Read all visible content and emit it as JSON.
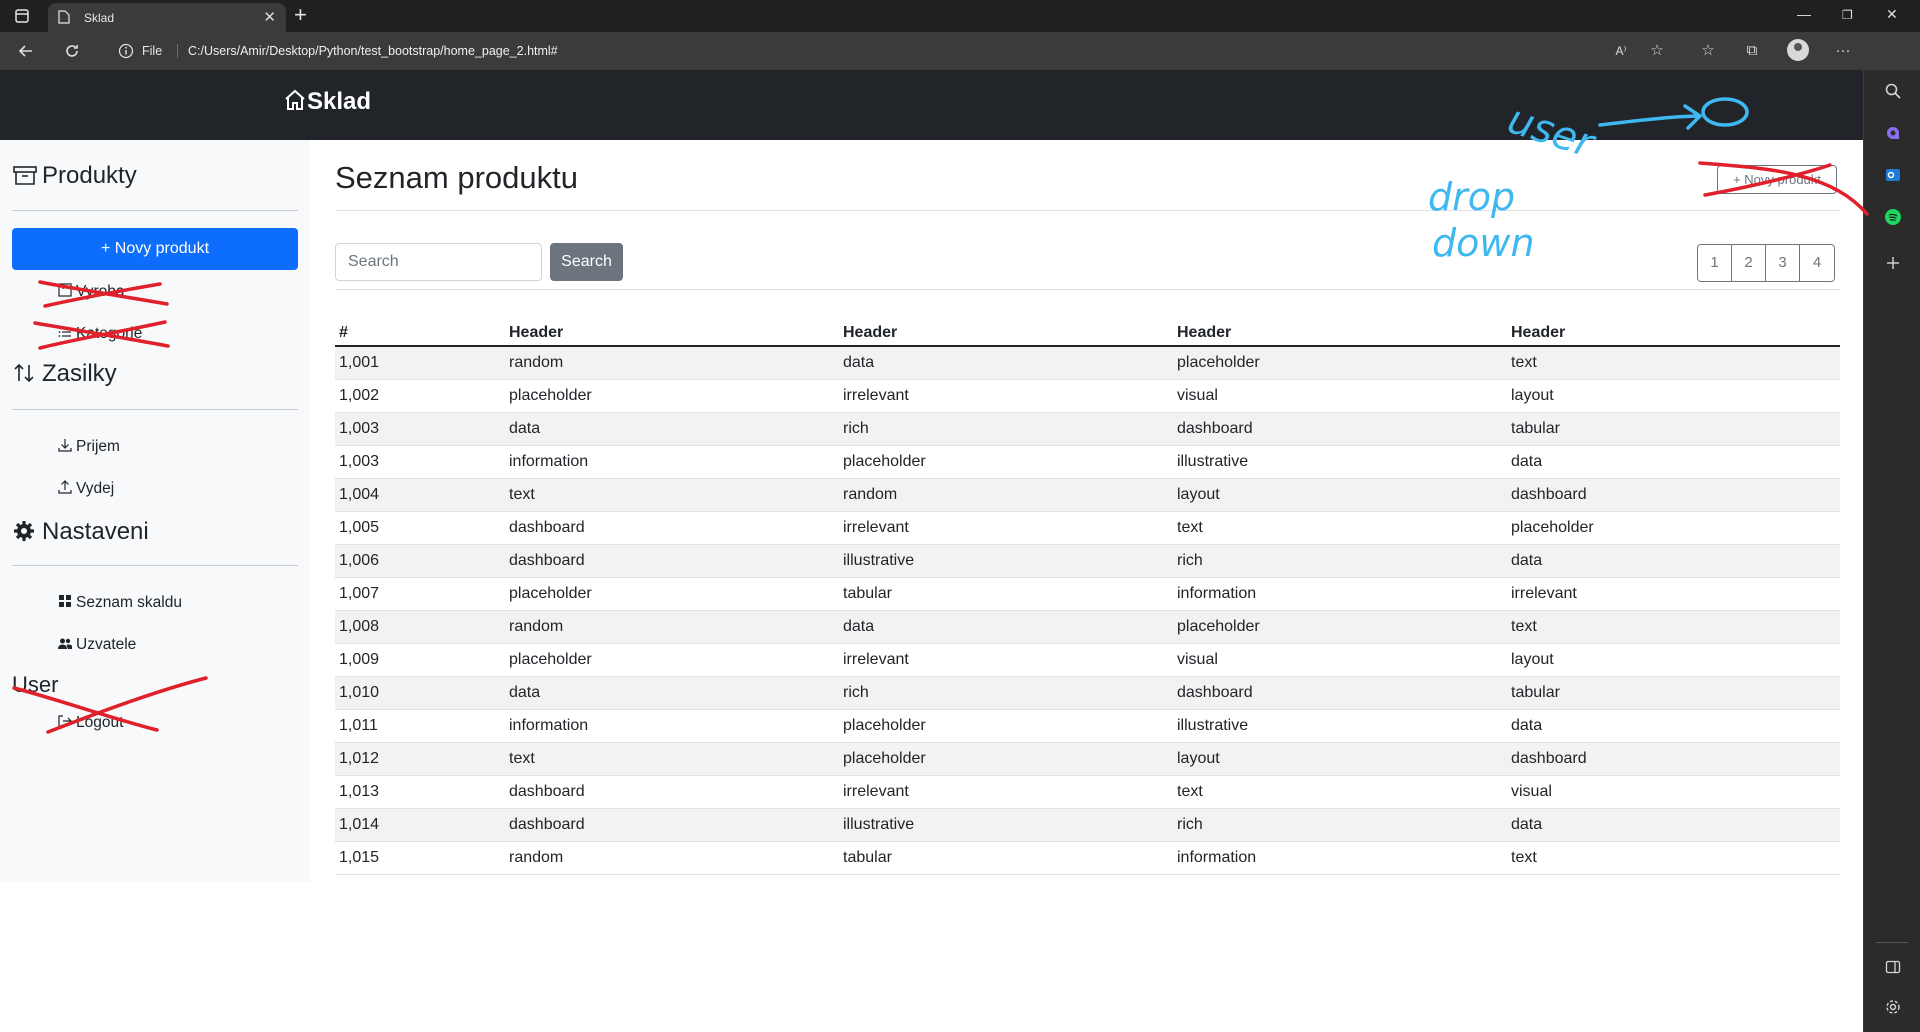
{
  "browser": {
    "tab_title": "Sklad",
    "file_label": "File",
    "url": "C:/Users/Amir/Desktop/Python/test_bootstrap/home_page_2.html#",
    "read_aloud_label": "A⁾"
  },
  "navbar": {
    "brand": "Sklad"
  },
  "sidebar": {
    "produkty": {
      "title": "Produkty",
      "new_button": "+ Novy produkt",
      "links": [
        "Vyroba",
        "Kategorie"
      ]
    },
    "zasilky": {
      "title": "Zasilky",
      "links": [
        "Prijem",
        "Vydej"
      ]
    },
    "nastaveni": {
      "title": "Nastaveni",
      "links": [
        "Seznam skaldu",
        "Uzvatele"
      ]
    },
    "user": {
      "title": "User",
      "links": [
        "Logout"
      ]
    }
  },
  "main": {
    "title": "Seznam produktu",
    "new_product_button": "+ Novy produkt",
    "search": {
      "placeholder": "Search",
      "button": "Search"
    },
    "pagination": [
      "1",
      "2",
      "3",
      "4"
    ]
  },
  "table": {
    "headers": [
      "#",
      "Header",
      "Header",
      "Header",
      "Header"
    ],
    "rows": [
      [
        "1,001",
        "random",
        "data",
        "placeholder",
        "text"
      ],
      [
        "1,002",
        "placeholder",
        "irrelevant",
        "visual",
        "layout"
      ],
      [
        "1,003",
        "data",
        "rich",
        "dashboard",
        "tabular"
      ],
      [
        "1,003",
        "information",
        "placeholder",
        "illustrative",
        "data"
      ],
      [
        "1,004",
        "text",
        "random",
        "layout",
        "dashboard"
      ],
      [
        "1,005",
        "dashboard",
        "irrelevant",
        "text",
        "placeholder"
      ],
      [
        "1,006",
        "dashboard",
        "illustrative",
        "rich",
        "data"
      ],
      [
        "1,007",
        "placeholder",
        "tabular",
        "information",
        "irrelevant"
      ],
      [
        "1,008",
        "random",
        "data",
        "placeholder",
        "text"
      ],
      [
        "1,009",
        "placeholder",
        "irrelevant",
        "visual",
        "layout"
      ],
      [
        "1,010",
        "data",
        "rich",
        "dashboard",
        "tabular"
      ],
      [
        "1,011",
        "information",
        "placeholder",
        "illustrative",
        "data"
      ],
      [
        "1,012",
        "text",
        "placeholder",
        "layout",
        "dashboard"
      ],
      [
        "1,013",
        "dashboard",
        "irrelevant",
        "text",
        "visual"
      ],
      [
        "1,014",
        "dashboard",
        "illustrative",
        "rich",
        "data"
      ],
      [
        "1,015",
        "random",
        "tabular",
        "information",
        "text"
      ]
    ]
  },
  "annotations": {
    "handwritten_note": "user drop down",
    "ink_colors": {
      "strike": "#e0202a",
      "note": "#3fb8f0"
    }
  },
  "colors": {
    "primary": "#0d6efd",
    "navbar": "#212529",
    "sidebar_bg": "#f8f9fa",
    "secondary": "#6c757d"
  }
}
